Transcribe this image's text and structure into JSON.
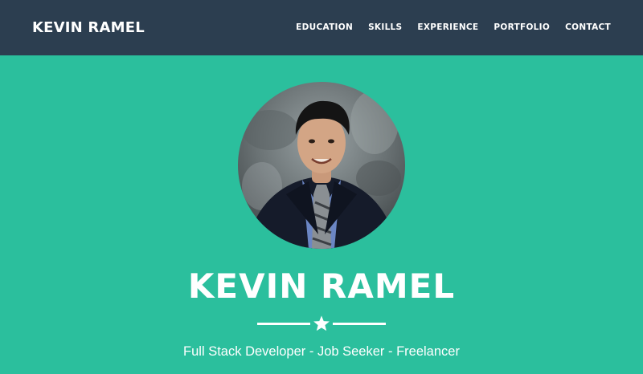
{
  "navbar": {
    "brand": "KEVIN RAMEL",
    "links": [
      "EDUCATION",
      "SKILLS",
      "EXPERIENCE",
      "PORTFOLIO",
      "CONTACT"
    ]
  },
  "hero": {
    "name": "KEVIN RAMEL",
    "tagline": "Full Stack Developer - Job Seeker - Freelancer",
    "divider_icon": "star-icon",
    "avatar_icon": "profile-photo"
  },
  "colors": {
    "navbar": "#2c3e50",
    "hero_background": "#2bbf9d",
    "text": "#ffffff"
  }
}
